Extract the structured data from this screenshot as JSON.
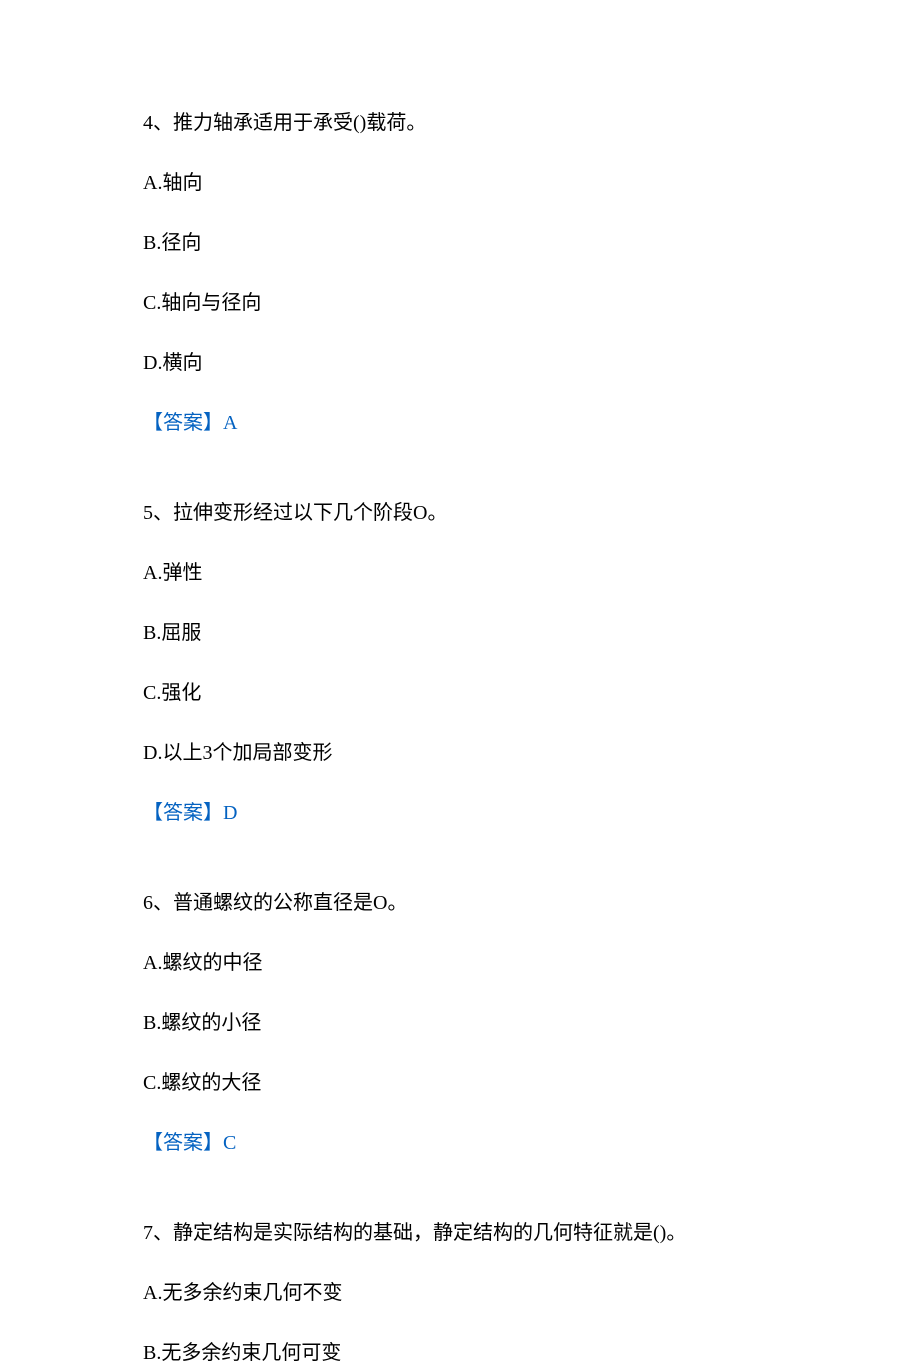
{
  "questions": [
    {
      "number": "4、",
      "text": "推力轴承适用于承受()载荷。",
      "options": [
        {
          "label": "A.",
          "text": "轴向"
        },
        {
          "label": "B.",
          "text": "径向"
        },
        {
          "label": "C.",
          "text": "轴向与径向"
        },
        {
          "label": "D.",
          "text": "横向"
        }
      ],
      "answer_label": "【答案】",
      "answer_value": "A"
    },
    {
      "number": "5、",
      "text": "拉伸变形经过以下几个阶段O。",
      "options": [
        {
          "label": "A.",
          "text": "弹性"
        },
        {
          "label": "B.",
          "text": "屈服"
        },
        {
          "label": "C.",
          "text": "强化"
        },
        {
          "label": "D.",
          "text": "以上3个加局部变形"
        }
      ],
      "answer_label": "【答案】",
      "answer_value": "D"
    },
    {
      "number": "6、",
      "text": "普通螺纹的公称直径是O。",
      "options": [
        {
          "label": "A.",
          "text": "螺纹的中径"
        },
        {
          "label": "B.",
          "text": "螺纹的小径"
        },
        {
          "label": "C.",
          "text": "螺纹的大径"
        }
      ],
      "answer_label": "【答案】",
      "answer_value": "C"
    },
    {
      "number": "7、",
      "text": "静定结构是实际结构的基础，静定结构的几何特征就是()。",
      "options": [
        {
          "label": "A.",
          "text": "无多余约束几何不变"
        },
        {
          "label": "B.",
          "text": "无多余约束几何可变"
        }
      ],
      "answer_label": "",
      "answer_value": ""
    }
  ]
}
